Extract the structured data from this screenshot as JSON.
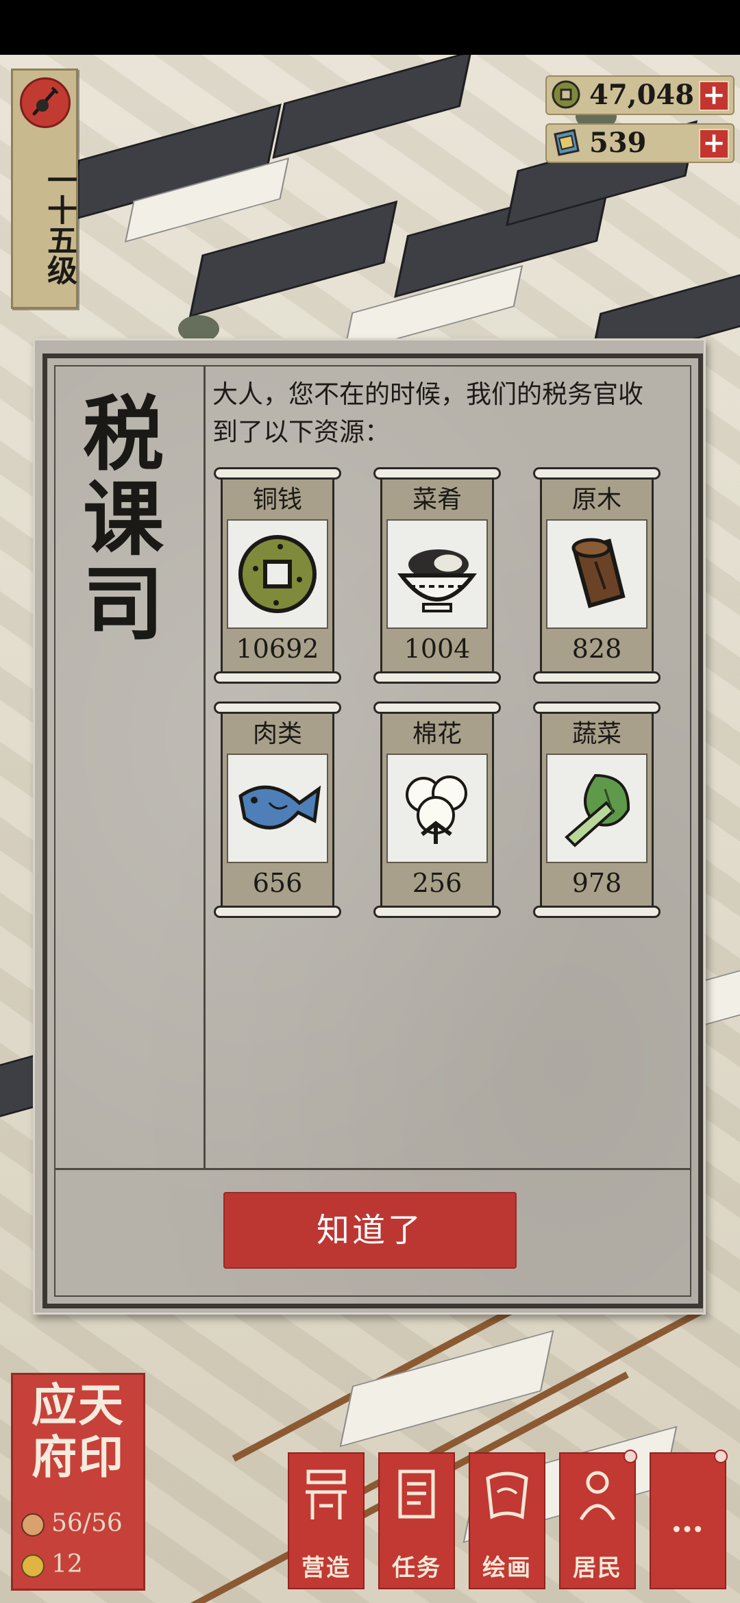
{
  "level": {
    "label": "一十五级"
  },
  "currency": {
    "copper": {
      "value": "47,048",
      "plus": "+",
      "icon": "copper-coin-icon"
    },
    "jade": {
      "value": "539",
      "plus": "+",
      "icon": "jade-gem-icon"
    }
  },
  "dialog": {
    "office_title": "税课司",
    "message": "大人，您不在的时候，我们的税务官收到了以下资源：",
    "resources": [
      {
        "name": "铜钱",
        "amount": "10692",
        "icon": "copper-coin-icon"
      },
      {
        "name": "菜肴",
        "amount": "1004",
        "icon": "dish-bowl-icon"
      },
      {
        "name": "原木",
        "amount": "828",
        "icon": "log-wood-icon"
      },
      {
        "name": "肉类",
        "amount": "656",
        "icon": "fish-meat-icon"
      },
      {
        "name": "棉花",
        "amount": "256",
        "icon": "cotton-icon"
      },
      {
        "name": "蔬菜",
        "amount": "978",
        "icon": "vegetable-icon"
      }
    ],
    "confirm_label": "知道了"
  },
  "hud": {
    "city_seal": "应天府印",
    "population": "56/56",
    "other_stat": "12",
    "buttons": [
      {
        "label": "营造",
        "icon": "build-icon"
      },
      {
        "label": "任务",
        "icon": "task-scroll-icon"
      },
      {
        "label": "绘画",
        "icon": "painting-icon"
      },
      {
        "label": "居民",
        "icon": "resident-icon"
      },
      {
        "label": "…",
        "icon": "more-icon"
      }
    ]
  },
  "colors": {
    "accent_red": "#bd3732",
    "paper": "#b6b2aa",
    "ink": "#1b1916"
  }
}
